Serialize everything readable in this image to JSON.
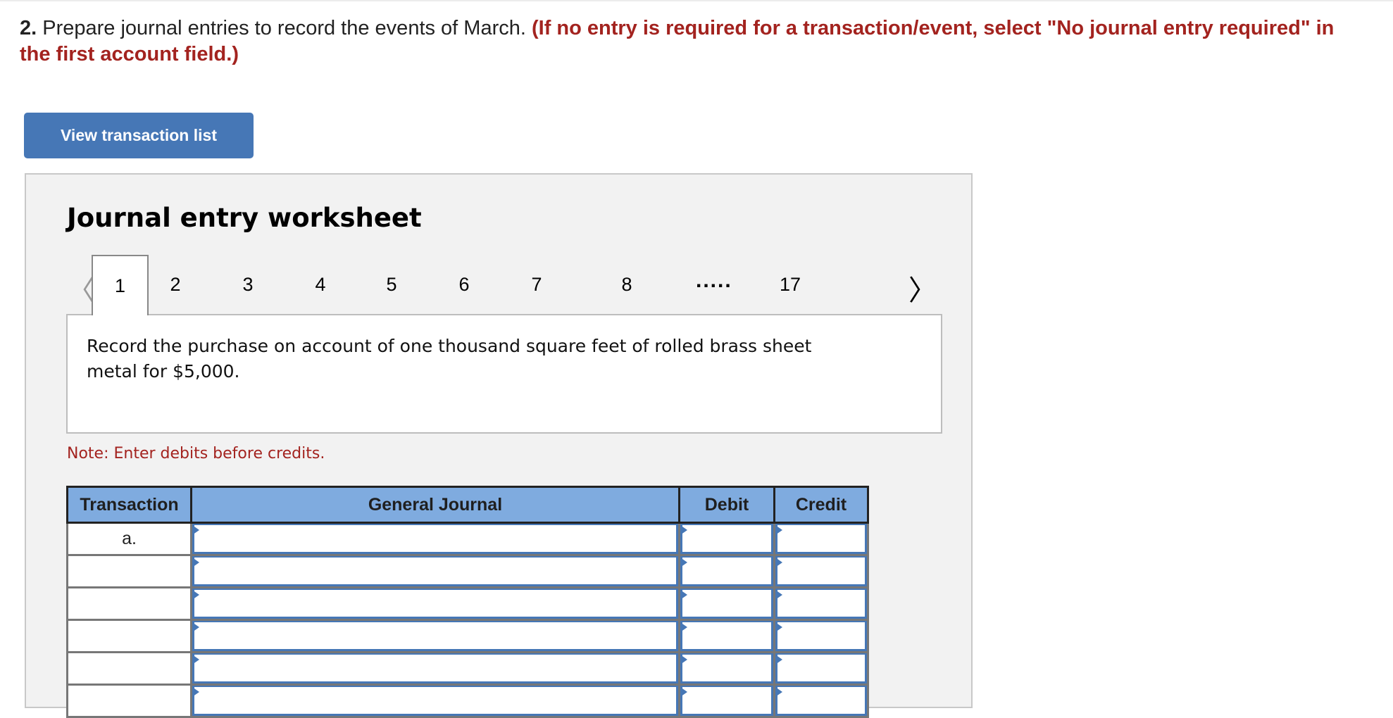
{
  "question": {
    "number": "2.",
    "text": " Prepare journal entries to record the events of March. ",
    "instruction": "(If no entry is required for a transaction/event, select \"No journal entry required\" in the first account field.)"
  },
  "view_transaction_button": "View transaction list",
  "worksheet": {
    "title": "Journal entry worksheet",
    "tabs": [
      "1",
      "2",
      "3",
      "4",
      "5",
      "6",
      "7",
      "8"
    ],
    "ellipsis": ".....",
    "last_tab": "17",
    "active_tab": "1",
    "prev_icon": "chevron-left-icon",
    "next_icon": "chevron-right-icon",
    "description": "Record the purchase on account of one thousand square feet of rolled brass sheet metal for $5,000.",
    "note": "Note: Enter debits before credits."
  },
  "table": {
    "headers": [
      "Transaction",
      "General Journal",
      "Debit",
      "Credit"
    ],
    "rows": [
      {
        "transaction": "a.",
        "account": "",
        "debit": "",
        "credit": ""
      },
      {
        "transaction": "",
        "account": "",
        "debit": "",
        "credit": ""
      },
      {
        "transaction": "",
        "account": "",
        "debit": "",
        "credit": ""
      },
      {
        "transaction": "",
        "account": "",
        "debit": "",
        "credit": ""
      },
      {
        "transaction": "",
        "account": "",
        "debit": "",
        "credit": ""
      },
      {
        "transaction": "",
        "account": "",
        "debit": "",
        "credit": ""
      }
    ]
  },
  "colors": {
    "accent": "#4677b6",
    "header_bg": "#7fabdf",
    "instruction_red": "#a3231f",
    "panel_bg": "#f2f2f2"
  }
}
